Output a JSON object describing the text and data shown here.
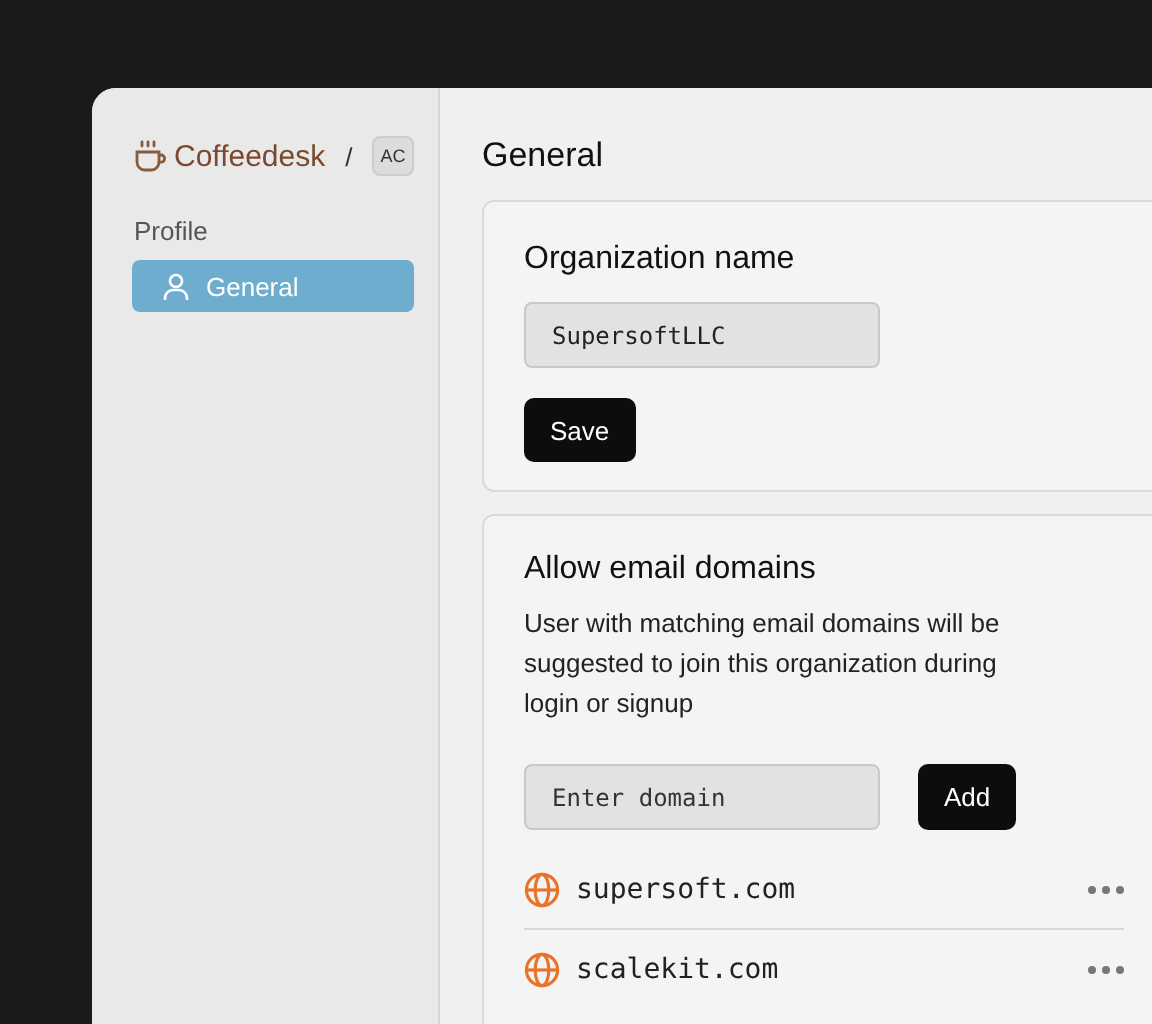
{
  "sidebar": {
    "brand": "Coffeedesk",
    "separator": "/",
    "org_badge": "AC",
    "section": "Profile",
    "items": [
      {
        "label": "General",
        "selected": true
      }
    ]
  },
  "page_title": "General",
  "org_card": {
    "title": "Organization name",
    "value": "SupersoftLLC",
    "button": "Save"
  },
  "domains_card": {
    "title": "Allow email domains",
    "description": "User with matching email domains will be suggested to join this organization during login or signup",
    "placeholder": "Enter domain",
    "button": "Add",
    "domains": [
      {
        "name": "supersoft.com"
      },
      {
        "name": "scalekit.com"
      }
    ]
  }
}
